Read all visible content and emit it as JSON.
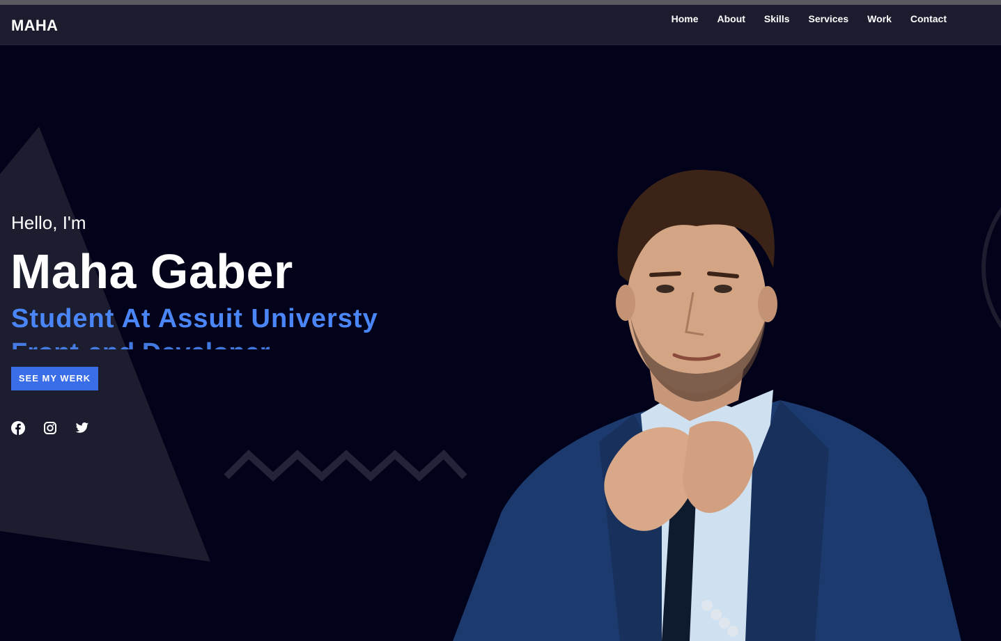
{
  "header": {
    "logo": "MAHA",
    "nav": [
      "Home",
      "About",
      "Skills",
      "Services",
      "Work",
      "Contact"
    ]
  },
  "hero": {
    "greeting": "Hello, I'm",
    "name": "Maha Gaber",
    "role": "Student At Assuit Universty",
    "role_next": "Front-end Developer",
    "cta_label": "SEE MY WERK"
  },
  "socials": [
    "facebook-icon",
    "instagram-icon",
    "twitter-icon"
  ],
  "colors": {
    "background": "#02021a",
    "navbar": "#1b1c2e",
    "accent": "#4a86f7",
    "button": "#3a6ee8",
    "shape": "#1c1d2f"
  }
}
